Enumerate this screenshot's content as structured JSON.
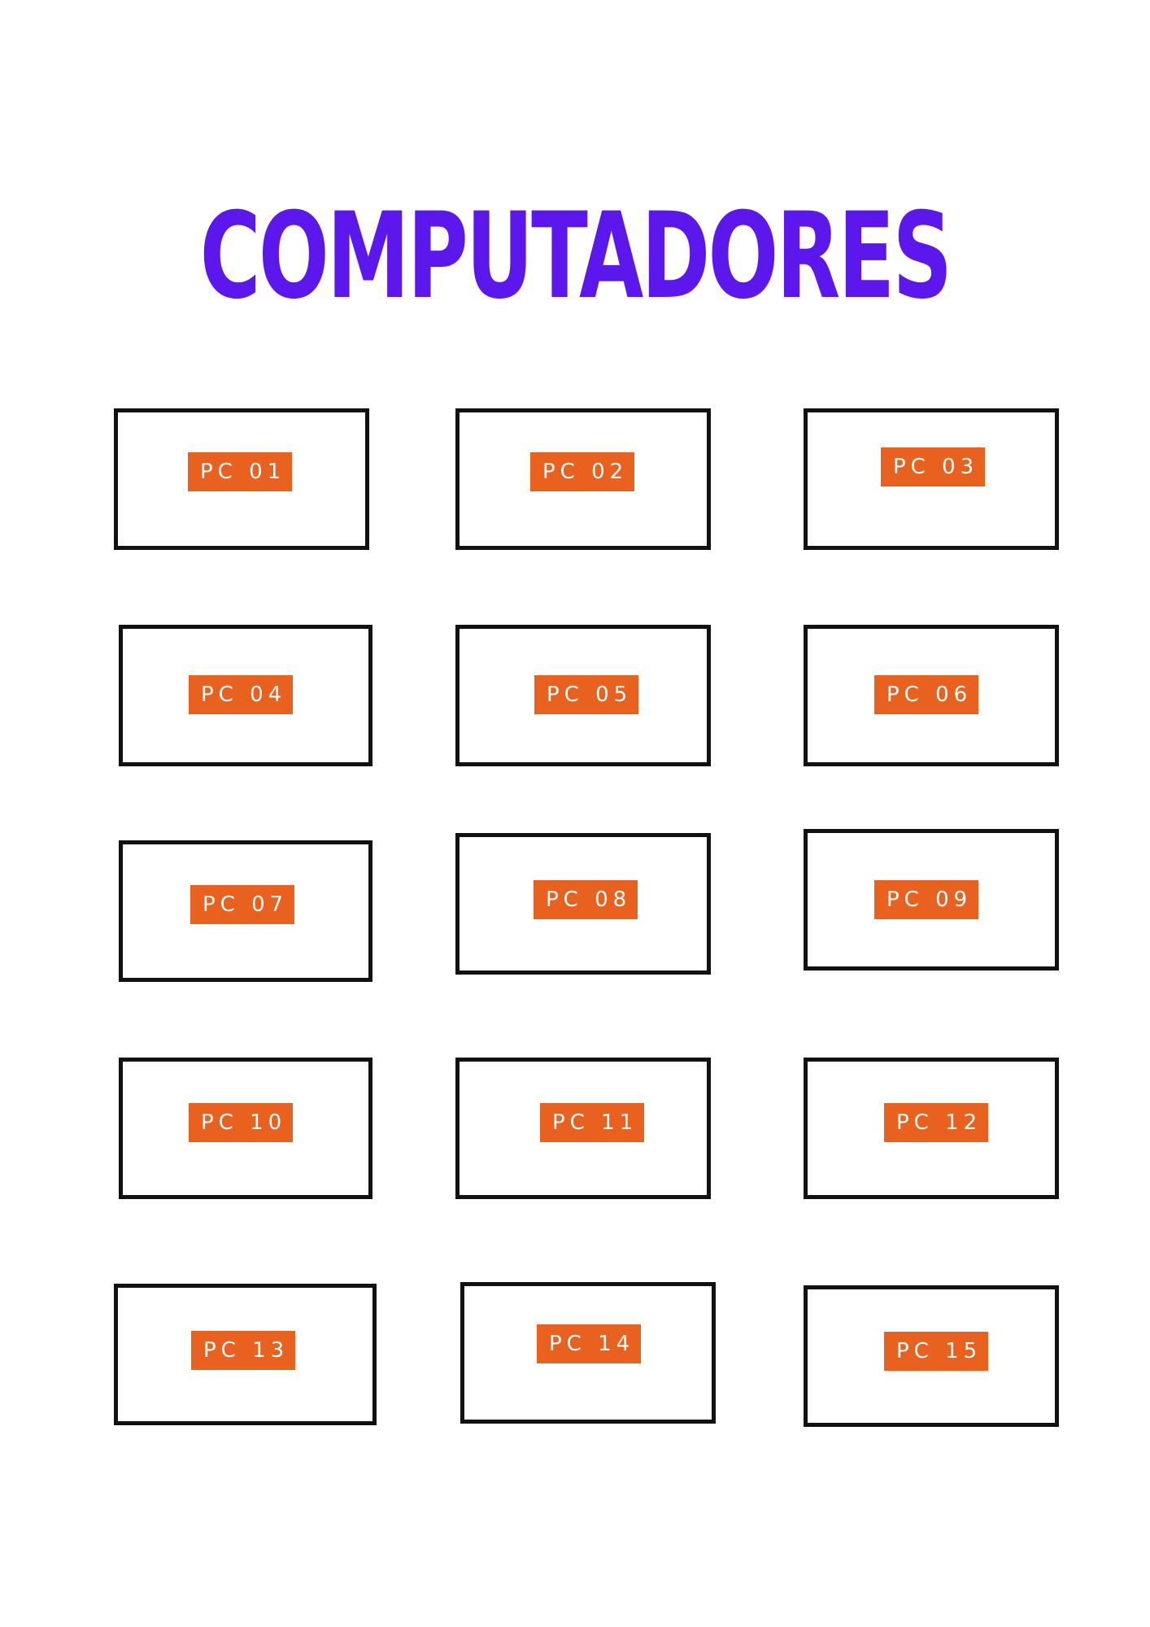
{
  "colors": {
    "title": "#5B17EC",
    "label_background": "#E8611F",
    "label_text": "#FFFFFF",
    "card_border": "#111111",
    "page_background": "#FFFFFF"
  },
  "title": "COMPUTADORES",
  "computers": [
    {
      "label": "PC 01"
    },
    {
      "label": "PC 02"
    },
    {
      "label": "PC 03"
    },
    {
      "label": "PC 04"
    },
    {
      "label": "PC 05"
    },
    {
      "label": "PC 06"
    },
    {
      "label": "PC 07"
    },
    {
      "label": "PC 08"
    },
    {
      "label": "PC 09"
    },
    {
      "label": "PC 10"
    },
    {
      "label": "PC 11"
    },
    {
      "label": "PC 12"
    },
    {
      "label": "PC 13"
    },
    {
      "label": "PC 14"
    },
    {
      "label": "PC 15"
    }
  ]
}
